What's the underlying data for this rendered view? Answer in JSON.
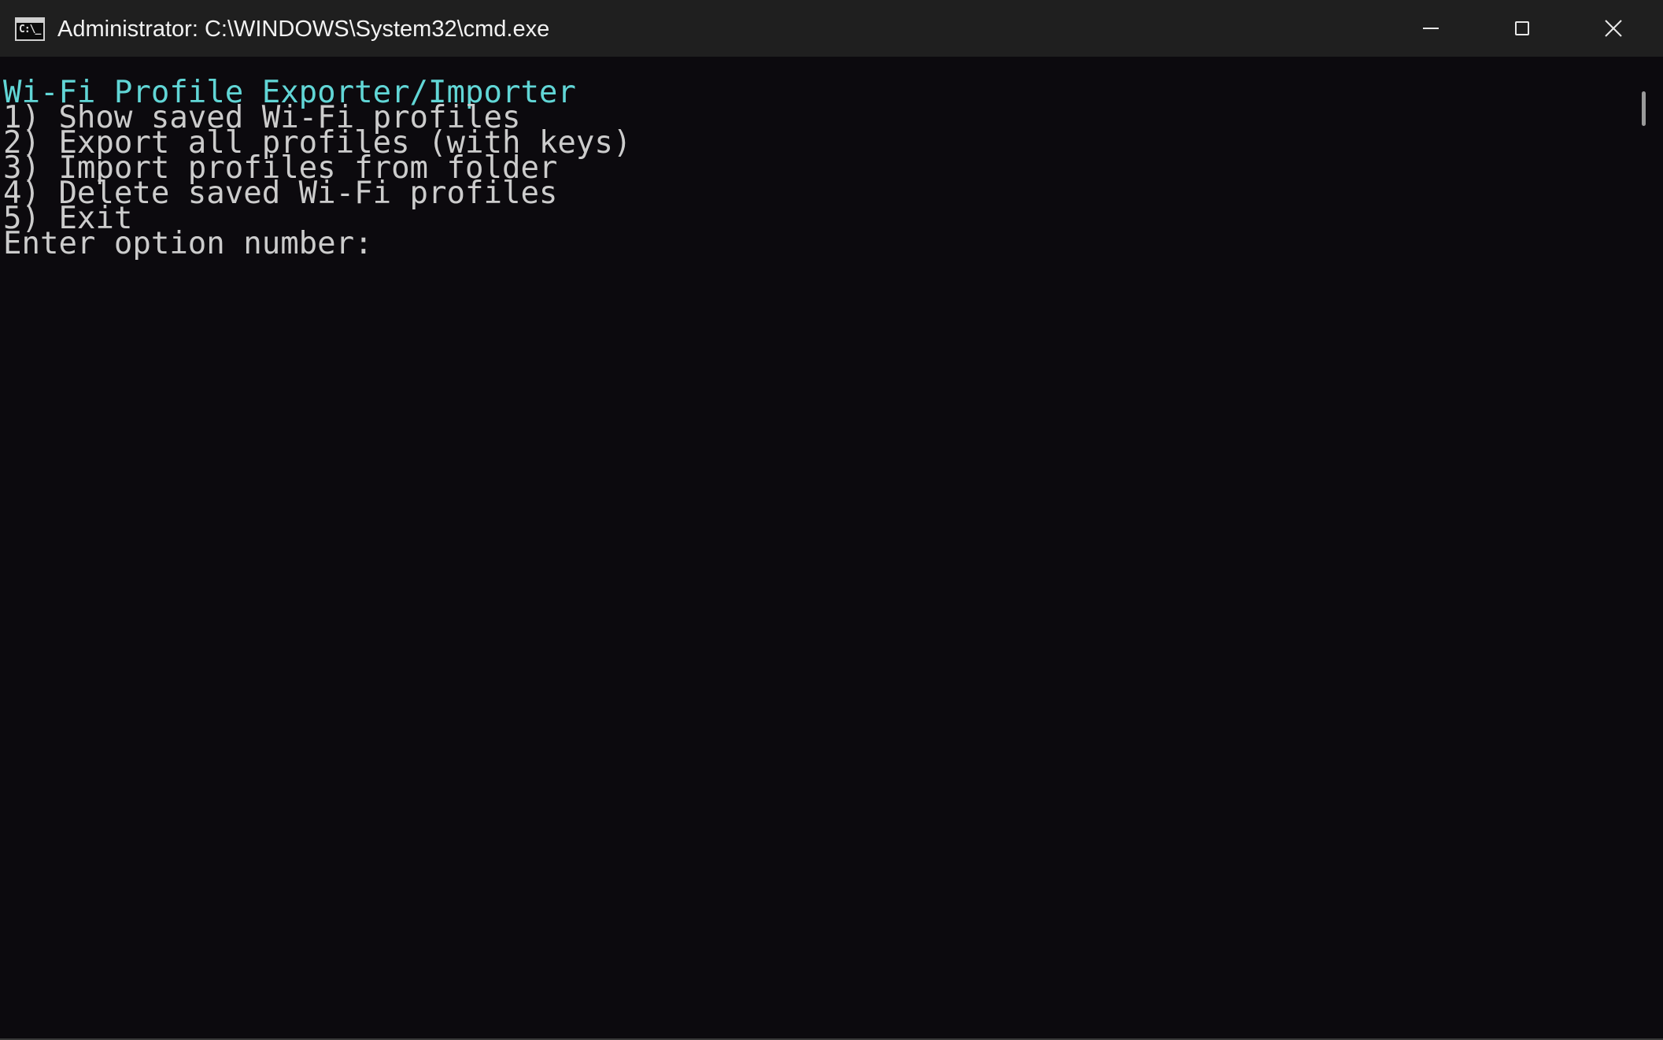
{
  "window": {
    "title": "Administrator: C:\\WINDOWS\\System32\\cmd.exe",
    "app_icon_text": "C:\\_",
    "app_icon": "cmd-icon"
  },
  "caption_buttons": {
    "minimize": "minimize-icon",
    "maximize": "maximize-icon",
    "close": "close-icon"
  },
  "colors": {
    "header_text": "#61d6d6",
    "body_text": "#cccccc",
    "background": "#0c0a0e",
    "titlebar": "#1f1f1f"
  },
  "terminal": {
    "header": "Wi-Fi Profile Exporter/Importer",
    "options": [
      "1) Show saved Wi-Fi profiles",
      "2) Export all profiles (with keys)",
      "3) Import profiles from folder",
      "4) Delete saved Wi-Fi profiles",
      "5) Exit"
    ],
    "prompt": "Enter option number:"
  }
}
